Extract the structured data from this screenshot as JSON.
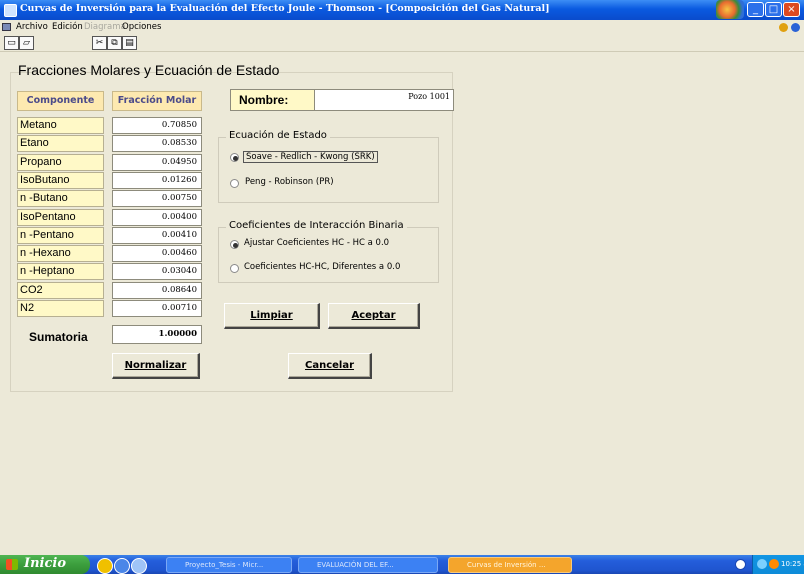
{
  "window": {
    "title": "Curvas de Inversión para la Evaluación del Efecto Joule - Thomson - [Composición del Gas Natural]"
  },
  "menu": {
    "items": [
      {
        "label": "Archivo",
        "enabled": true
      },
      {
        "label": "Edición",
        "enabled": true
      },
      {
        "label": "Diagrama",
        "enabled": false
      },
      {
        "label": "Opciones",
        "enabled": true
      }
    ]
  },
  "toolbar": {
    "icons": [
      "new-icon",
      "open-icon",
      "cut-icon",
      "copy-icon",
      "paste-icon"
    ]
  },
  "form": {
    "title": "Fracciones Molares y Ecuación de Estado",
    "col_componente": "Componente",
    "col_fraccion": "Fracción Molar",
    "components": [
      {
        "name": "Metano",
        "value": "0.70850"
      },
      {
        "name": "Etano",
        "value": "0.08530"
      },
      {
        "name": "Propano",
        "value": "0.04950"
      },
      {
        "name": "IsoButano",
        "value": "0.01260"
      },
      {
        "name": "n -Butano",
        "value": "0.00750"
      },
      {
        "name": "IsoPentano",
        "value": "0.00400"
      },
      {
        "name": "n -Pentano",
        "value": "0.00410"
      },
      {
        "name": "n -Hexano",
        "value": "0.00460"
      },
      {
        "name": "n -Heptano",
        "value": "0.03040"
      },
      {
        "name": "CO2",
        "value": "0.08640"
      },
      {
        "name": "N2",
        "value": "0.00710"
      }
    ],
    "sumatoria_label": "Sumatoria",
    "sumatoria_value": "1.00000",
    "nombre_label": "Nombre:",
    "nombre_value": "Pozo 1001",
    "eos_group": "Ecuación de Estado",
    "eos_options": [
      {
        "label": "Soave - Redlich - Kwong (SRK)",
        "selected": true
      },
      {
        "label": "Peng - Robinson (PR)",
        "selected": false
      }
    ],
    "bic_group": "Coeficientes de Interacción Binaria",
    "bic_options": [
      {
        "label": "Ajustar Coeficientes HC - HC a 0.0",
        "selected": true
      },
      {
        "label": "Coeficientes HC-HC, Diferentes a 0.0",
        "selected": false
      }
    ],
    "buttons": {
      "limpiar": "Limpiar",
      "aceptar": "Aceptar",
      "normalizar": "Normalizar",
      "cancelar": "Cancelar"
    }
  },
  "taskbar": {
    "start": "Inicio",
    "tasks": [
      {
        "label": "Proyecto_Tesis - Micr...",
        "active": false
      },
      {
        "label": "EVALUACIÓN DEL EF...",
        "active": false
      },
      {
        "label": "Curvas de Inversión ...",
        "active": true
      }
    ],
    "clock": "10:25 a.m"
  },
  "colors": {
    "titlebar": "#0a5ae0",
    "header_fill": "#fde9b0",
    "label_fill": "#fff9c7",
    "active_task": "#f4a52c"
  }
}
